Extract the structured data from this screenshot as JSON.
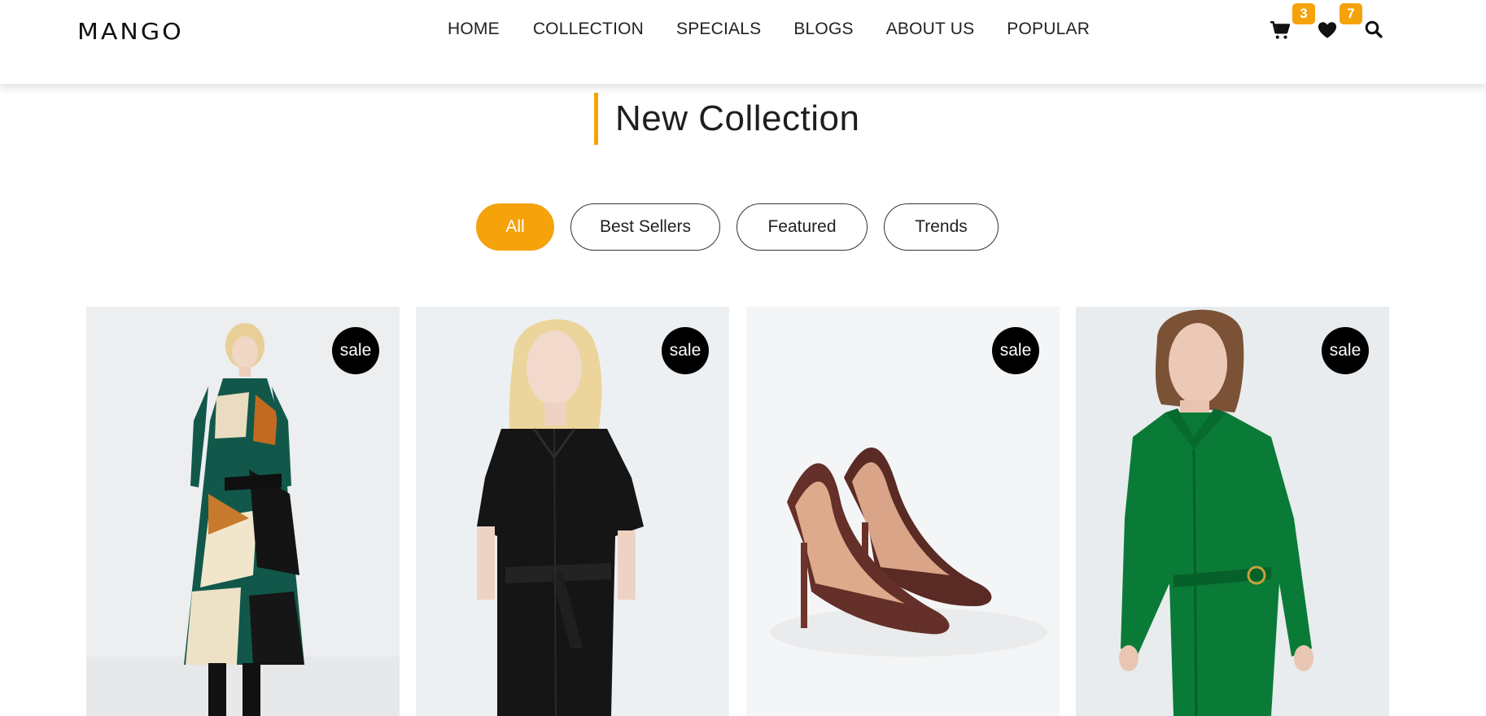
{
  "brand": {
    "logo": "MANGO"
  },
  "nav": {
    "items": [
      "HOME",
      "COLLECTION",
      "SPECIALS",
      "BLOGS",
      "ABOUT US",
      "POPULAR"
    ]
  },
  "header_icons": {
    "cart": {
      "icon": "cart-icon",
      "count": "3"
    },
    "wishlist": {
      "icon": "heart-icon",
      "count": "7"
    },
    "search": {
      "icon": "search-icon"
    },
    "accent_color": "#f5a20b"
  },
  "section": {
    "title": "New Collection"
  },
  "filters": {
    "items": [
      "All",
      "Best Sellers",
      "Featured",
      "Trends"
    ],
    "active": "All"
  },
  "products": [
    {
      "badge": "sale",
      "image": "patterned-shirt-dress-photo"
    },
    {
      "badge": "sale",
      "image": "black-leather-shirt-dress-photo"
    },
    {
      "badge": "sale",
      "image": "brown-croc-pumps-photo"
    },
    {
      "badge": "sale",
      "image": "green-wrap-shirt-dress-photo"
    }
  ]
}
